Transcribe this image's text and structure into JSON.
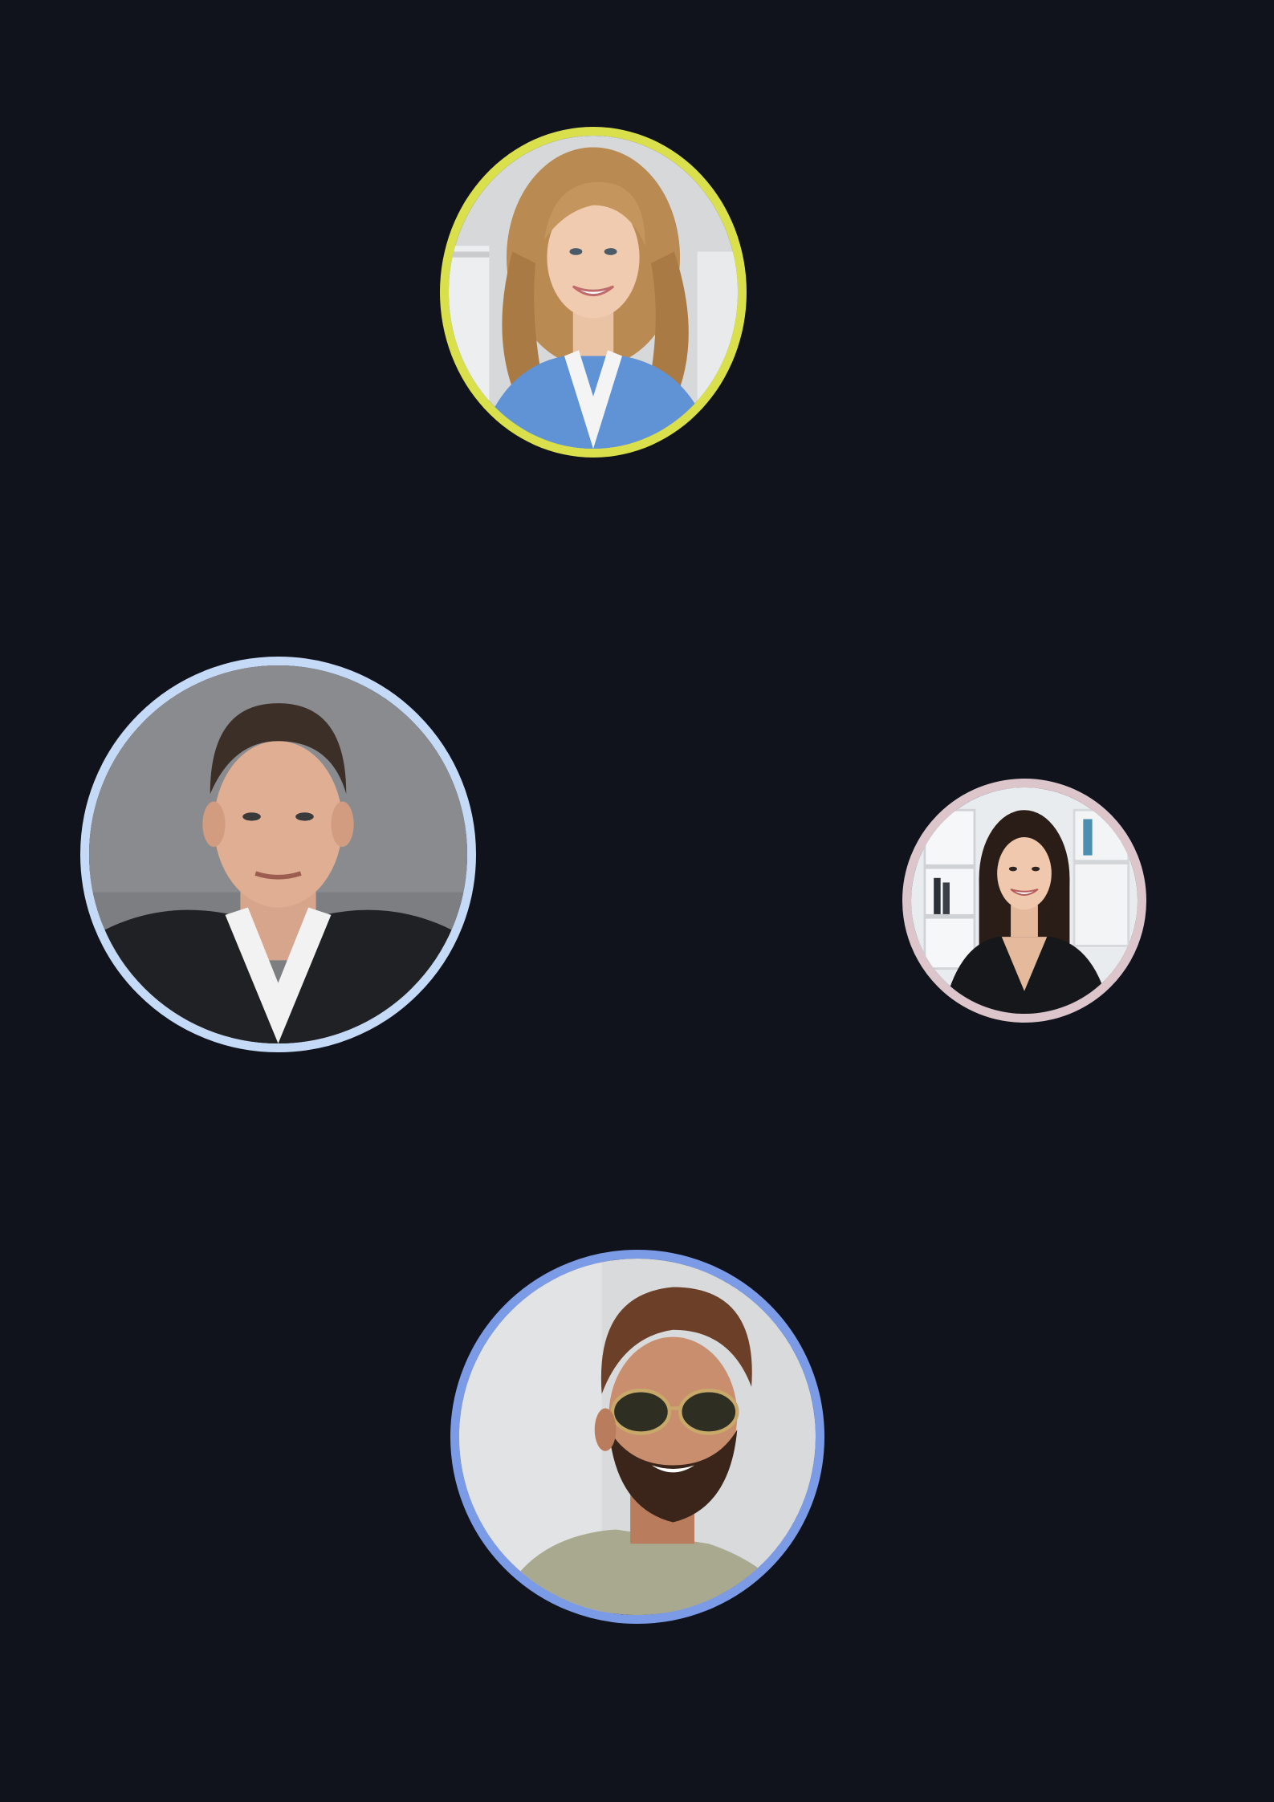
{
  "background_color": "#10121c",
  "avatars": [
    {
      "name": "avatar-woman-blonde",
      "ring_color": "#d9e04c",
      "description_icon": "portrait-photo"
    },
    {
      "name": "avatar-man-suit",
      "ring_color": "#c5daf7",
      "description_icon": "portrait-photo"
    },
    {
      "name": "avatar-woman-brunette",
      "ring_color": "#dcc6cb",
      "description_icon": "portrait-photo"
    },
    {
      "name": "avatar-man-sunglasses",
      "ring_color": "#7c9be6",
      "description_icon": "portrait-photo"
    }
  ]
}
